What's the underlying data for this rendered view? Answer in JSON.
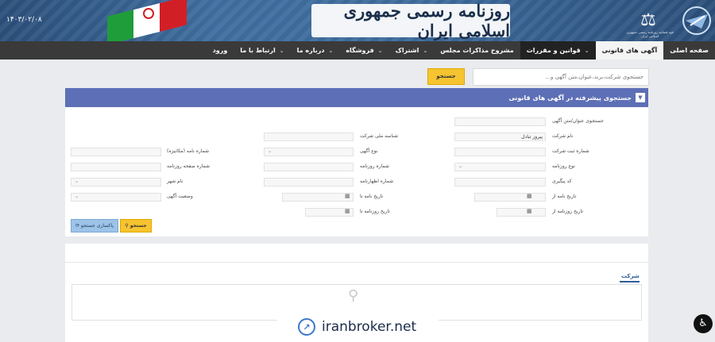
{
  "header": {
    "title": "روزنامه رسمی جمهوری اسلامی ایران",
    "date": "۱۴۰۳/۰۲/۰۸",
    "logo_icon": "gazette-logo-icon",
    "scales_icon": "scales-of-justice-icon",
    "scales_caption": "قوه قضائیه روزنامه رسمی جمهوری اسلامی ایران"
  },
  "nav": {
    "items": [
      {
        "label": "صفحه اصلی",
        "dropdown": false,
        "state": "normal"
      },
      {
        "label": "آگهی های قانونی",
        "dropdown": false,
        "state": "active"
      },
      {
        "label": "قوانین و مقررات",
        "dropdown": true,
        "state": "dark"
      },
      {
        "label": "مشروح مذاکرات مجلس",
        "dropdown": false,
        "state": "normal"
      },
      {
        "label": "اشتراک",
        "dropdown": true,
        "state": "normal"
      },
      {
        "label": "فروشگاه",
        "dropdown": true,
        "state": "normal"
      },
      {
        "label": "درباره ما",
        "dropdown": true,
        "state": "normal"
      },
      {
        "label": "ارتباط با ما",
        "dropdown": true,
        "state": "normal"
      },
      {
        "label": "ورود",
        "dropdown": false,
        "state": "normal"
      }
    ]
  },
  "search": {
    "placeholder": "جستجوی شرکت،برند،عنوان،متن آگهی و...",
    "button": "جستجو"
  },
  "advanced": {
    "title": "جستجوی پیشرفته در آگهی های قانونی",
    "fields": {
      "ad_title": {
        "label": "جستجوی عنوان/متن آگهی",
        "value": ""
      },
      "company_name": {
        "label": "نام شرکت",
        "value": "پیروز تبادل"
      },
      "national_id": {
        "label": "شناسه ملی شرکت",
        "value": ""
      },
      "reg_number": {
        "label": "شماره ثبت شرکت",
        "value": ""
      },
      "ad_type": {
        "label": "نوع آگهی",
        "value": ""
      },
      "letter_number": {
        "label": "شماره نامه (مکانیزه)",
        "value": ""
      },
      "newspaper_type": {
        "label": "نوع روزنامه",
        "value": ""
      },
      "newspaper_number": {
        "label": "شماره روزنامه",
        "value": ""
      },
      "newspaper_page": {
        "label": "شماره صفحه روزنامه",
        "value": ""
      },
      "tracking_code": {
        "label": "کد پیگیری",
        "value": ""
      },
      "declaration_number": {
        "label": "شماره اظهارنامه",
        "value": ""
      },
      "city": {
        "label": "نام شهر",
        "value": ""
      },
      "letter_date_from": {
        "label": "تاریخ نامه از",
        "value": ""
      },
      "letter_date_to": {
        "label": "تاریخ نامه تا",
        "value": ""
      },
      "ad_status": {
        "label": "وضعیت آگهی",
        "value": ""
      },
      "news_date_from": {
        "label": "تاریخ روزنامه از",
        "value": ""
      },
      "news_date_to": {
        "label": "تاریخ روزنامه تا",
        "value": ""
      }
    },
    "search_button": "جستجو",
    "clear_button": "پاکسازی جستجو"
  },
  "results": {
    "tab_label": "شرکت"
  },
  "watermark": {
    "text": "iranbroker.net"
  }
}
